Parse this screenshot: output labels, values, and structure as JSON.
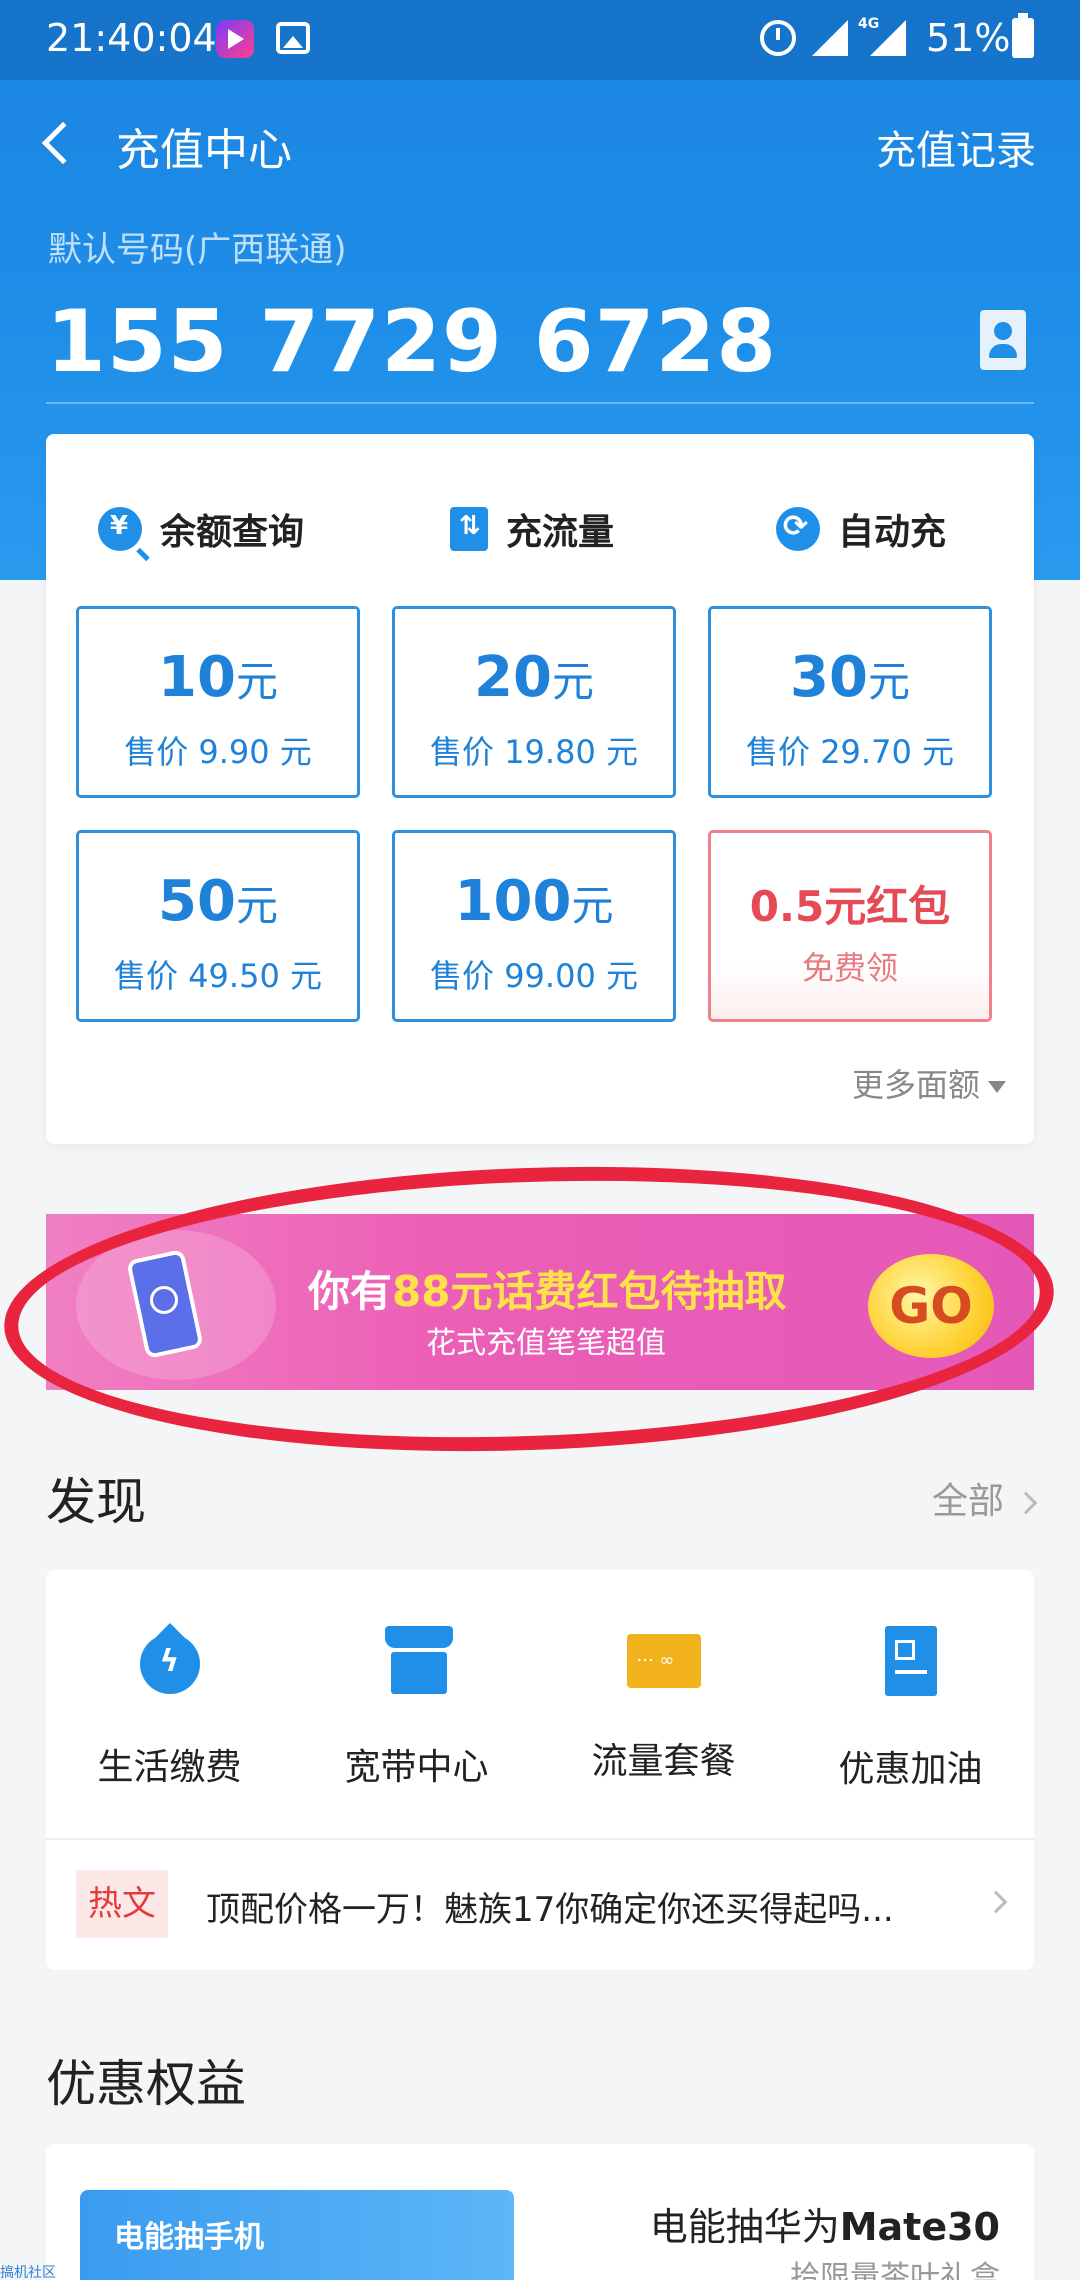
{
  "status_bar": {
    "time": "21:40:04",
    "network": "4G",
    "battery": "51%",
    "icons": [
      "video-app-icon",
      "gallery-icon",
      "alarm-icon",
      "signal-icon",
      "signal-4g-icon",
      "battery-icon"
    ]
  },
  "nav": {
    "title": "充值中心",
    "record": "充值记录"
  },
  "phone": {
    "label": "默认号码(广西联通)",
    "number": "155 7729 6728"
  },
  "quick_actions": [
    {
      "label": "余额查询",
      "icon": "balance-query-icon"
    },
    {
      "label": "充流量",
      "icon": "data-recharge-icon"
    },
    {
      "label": "自动充",
      "icon": "auto-recharge-icon"
    }
  ],
  "amounts": [
    {
      "value": "10",
      "unit": "元",
      "price": "售价 9.90 元"
    },
    {
      "value": "20",
      "unit": "元",
      "price": "售价 19.80 元"
    },
    {
      "value": "30",
      "unit": "元",
      "price": "售价 29.70 元"
    },
    {
      "value": "50",
      "unit": "元",
      "price": "售价 49.50 元"
    },
    {
      "value": "100",
      "unit": "元",
      "price": "售价 99.00 元"
    }
  ],
  "red_packet": {
    "value": "0.5",
    "label": "元红包",
    "sub": "免费领"
  },
  "more_amounts": "更多面额",
  "promo": {
    "title_prefix": "你有",
    "title_highlight": "88元话费红包待抽取",
    "subtitle": "花式充值笔笔超值",
    "go": "GO"
  },
  "discover": {
    "title": "发现",
    "all": "全部",
    "services": [
      {
        "label": "生活缴费",
        "icon": "utility-payment-icon"
      },
      {
        "label": "宽带中心",
        "icon": "broadband-icon"
      },
      {
        "label": "流量套餐",
        "icon": "data-plan-icon"
      },
      {
        "label": "优惠加油",
        "icon": "fuel-discount-icon"
      }
    ],
    "hot": {
      "tag": "热文",
      "text": "顶配价格一万！魅族17你确定你还买得起吗..."
    }
  },
  "benefits": {
    "title": "优惠权益",
    "image_text": "电能抽手机",
    "item_title_prefix": "电能抽华为",
    "item_title_bold": "Mate30",
    "item_sub": "拾限量茶叶礼盒"
  },
  "watermark": "搞机社区",
  "colors": {
    "brand_blue": "#1f8fe8",
    "amount_blue": "#1f82d8",
    "red": "#e54a55",
    "promo_pink": "#ec5fb6",
    "annotation_red": "#e8243e"
  }
}
